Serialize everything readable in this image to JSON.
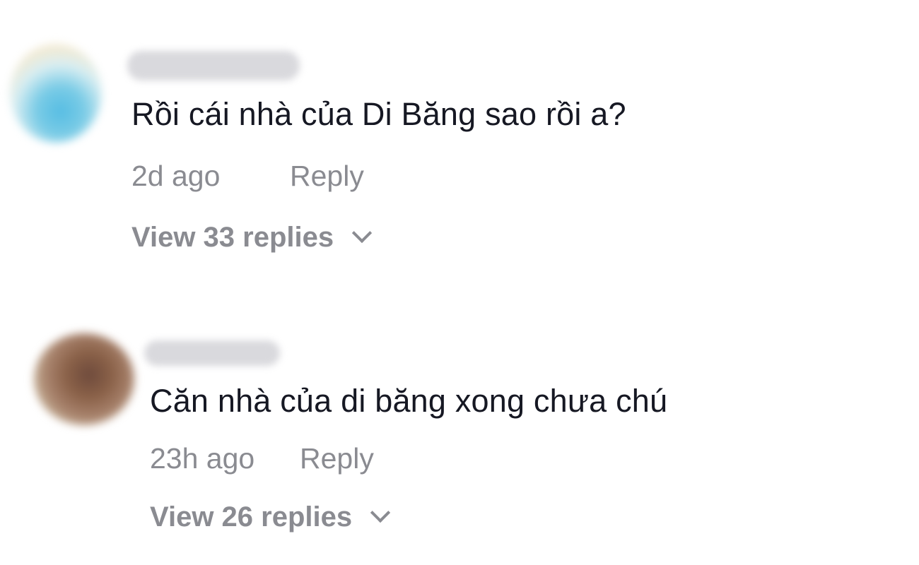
{
  "comments": [
    {
      "text": "Rồi cái nhà của Di Băng sao rồi a?",
      "time": "2d ago",
      "reply_label": "Reply",
      "view_replies_label": "View 33 replies"
    },
    {
      "text": "Căn nhà của di băng xong chưa chú",
      "time": "23h ago",
      "reply_label": "Reply",
      "view_replies_label": "View 26 replies"
    }
  ]
}
